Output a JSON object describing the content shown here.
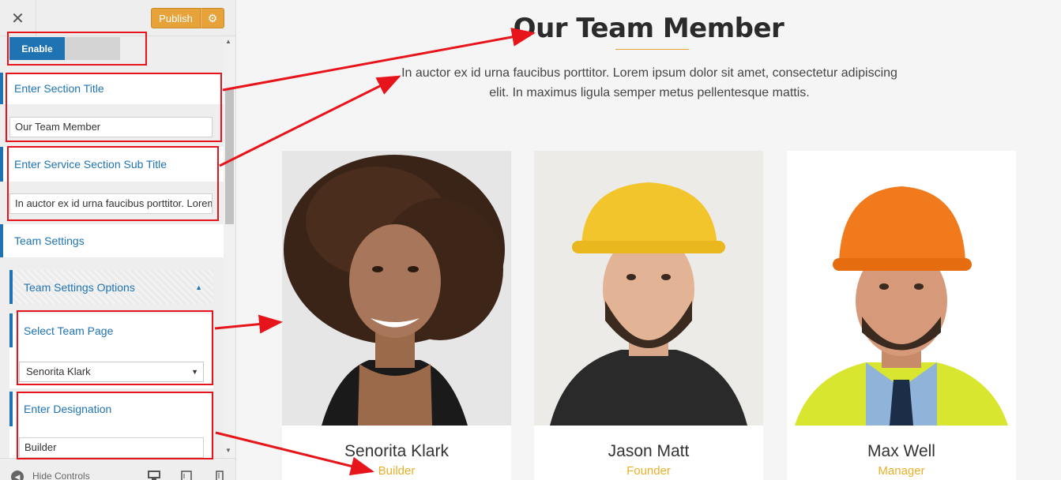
{
  "sidebar": {
    "close_glyph": "✕",
    "publish_label": "Publish",
    "gear_glyph": "⚙",
    "toggle": {
      "on_label": "Enable"
    },
    "section_title": {
      "heading": "Enter Section Title",
      "value": "Our Team Member"
    },
    "section_subtitle": {
      "heading": "Enter Service Section Sub Title",
      "value": "In auctor ex id urna faucibus porttitor. Lorem"
    },
    "team_settings": {
      "heading": "Team Settings"
    },
    "team_options": {
      "heading": "Team Settings Options",
      "caret": "▲"
    },
    "select_team": {
      "heading": "Select Team Page",
      "selected": "Senorita Klark",
      "arrow": "▼"
    },
    "designation": {
      "heading": "Enter Designation",
      "value": "Builder"
    },
    "scroll_up": "▲",
    "scroll_down": "▼",
    "bottom": {
      "hide_controls_icon": "◀",
      "hide_controls_label": "Hide Controls"
    }
  },
  "preview": {
    "title": "Our Team Member",
    "subtitle": "In auctor ex id urna faucibus porttitor. Lorem ipsum dolor sit amet, consectetur adipiscing elit. In maximus ligula semper metus pellentesque mattis.",
    "members": [
      {
        "name": "Senorita Klark",
        "role": "Builder"
      },
      {
        "name": "Jason Matt",
        "role": "Founder"
      },
      {
        "name": "Max Well",
        "role": "Manager"
      }
    ]
  },
  "colors": {
    "accent_blue": "#1f73b3",
    "publish_orange": "#e7a23a",
    "role_gold": "#e7b02a",
    "annotation_red": "#e8141b"
  },
  "icons": [
    "close-icon",
    "gear-icon",
    "caret-up-icon",
    "chevron-down-icon",
    "collapse-icon",
    "desktop-icon",
    "tablet-icon",
    "mobile-icon"
  ]
}
